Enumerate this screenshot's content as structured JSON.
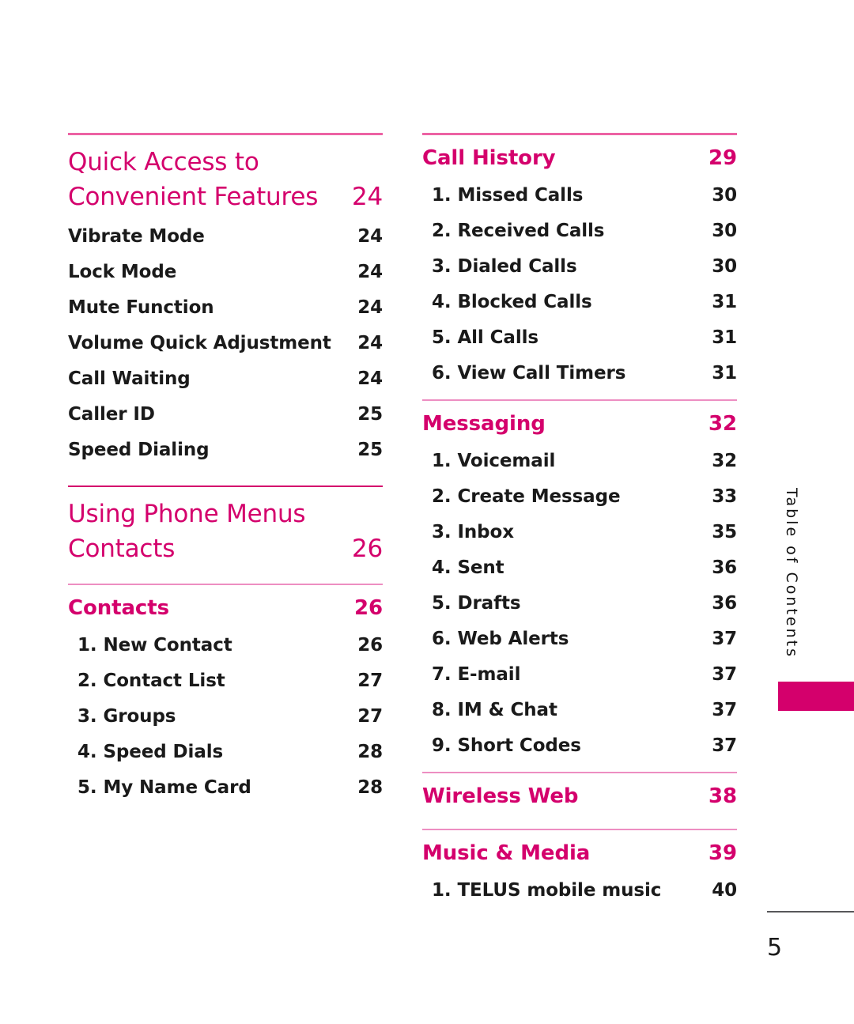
{
  "document": {
    "side_tab_label": "Table of Contents",
    "page_number": "5",
    "accent_color": "#d4006c",
    "rule_color_thick": "#ec62a4",
    "rule_color_thin": "#ed8ec2"
  },
  "left_column": {
    "section1": {
      "title_line1": "Quick Access to",
      "title_line2": "Convenient Features",
      "page": "24",
      "entries": [
        {
          "label": "Vibrate Mode",
          "page": "24"
        },
        {
          "label": "Lock Mode",
          "page": "24"
        },
        {
          "label": "Mute Function",
          "page": "24"
        },
        {
          "label": "Volume Quick Adjustment",
          "page": "24"
        },
        {
          "label": "Call Waiting",
          "page": "24"
        },
        {
          "label": "Caller ID",
          "page": "25"
        },
        {
          "label": "Speed Dialing",
          "page": "25"
        }
      ]
    },
    "section2": {
      "title_line1": "Using Phone Menus",
      "title_line2": "Contacts",
      "page": "26"
    },
    "section3": {
      "title": "Contacts",
      "page": "26",
      "entries": [
        {
          "label": "1. New Contact",
          "page": "26"
        },
        {
          "label": "2. Contact List",
          "page": "27"
        },
        {
          "label": "3. Groups",
          "page": "27"
        },
        {
          "label": "4. Speed Dials",
          "page": "28"
        },
        {
          "label": "5. My Name Card",
          "page": "28"
        }
      ]
    }
  },
  "right_column": {
    "section1": {
      "title": "Call History",
      "page": "29",
      "entries": [
        {
          "label": "1. Missed Calls",
          "page": "30"
        },
        {
          "label": "2. Received Calls",
          "page": "30"
        },
        {
          "label": "3. Dialed Calls",
          "page": "30"
        },
        {
          "label": "4. Blocked Calls",
          "page": "31"
        },
        {
          "label": "5. All Calls",
          "page": "31"
        },
        {
          "label": "6. View Call Timers",
          "page": "31"
        }
      ]
    },
    "section2": {
      "title": "Messaging",
      "page": "32",
      "entries": [
        {
          "label": "1. Voicemail",
          "page": "32"
        },
        {
          "label": "2. Create Message",
          "page": "33"
        },
        {
          "label": "3. Inbox",
          "page": "35"
        },
        {
          "label": "4. Sent",
          "page": "36"
        },
        {
          "label": "5. Drafts",
          "page": "36"
        },
        {
          "label": "6. Web Alerts",
          "page": "37"
        },
        {
          "label": "7. E-mail",
          "page": "37"
        },
        {
          "label": "8. IM & Chat",
          "page": "37"
        },
        {
          "label": "9. Short Codes",
          "page": "37"
        }
      ]
    },
    "section3": {
      "title": "Wireless Web",
      "page": "38"
    },
    "section4": {
      "title": "Music & Media",
      "page": "39",
      "entries": [
        {
          "label": "1. TELUS mobile music",
          "page": "40"
        }
      ]
    }
  }
}
